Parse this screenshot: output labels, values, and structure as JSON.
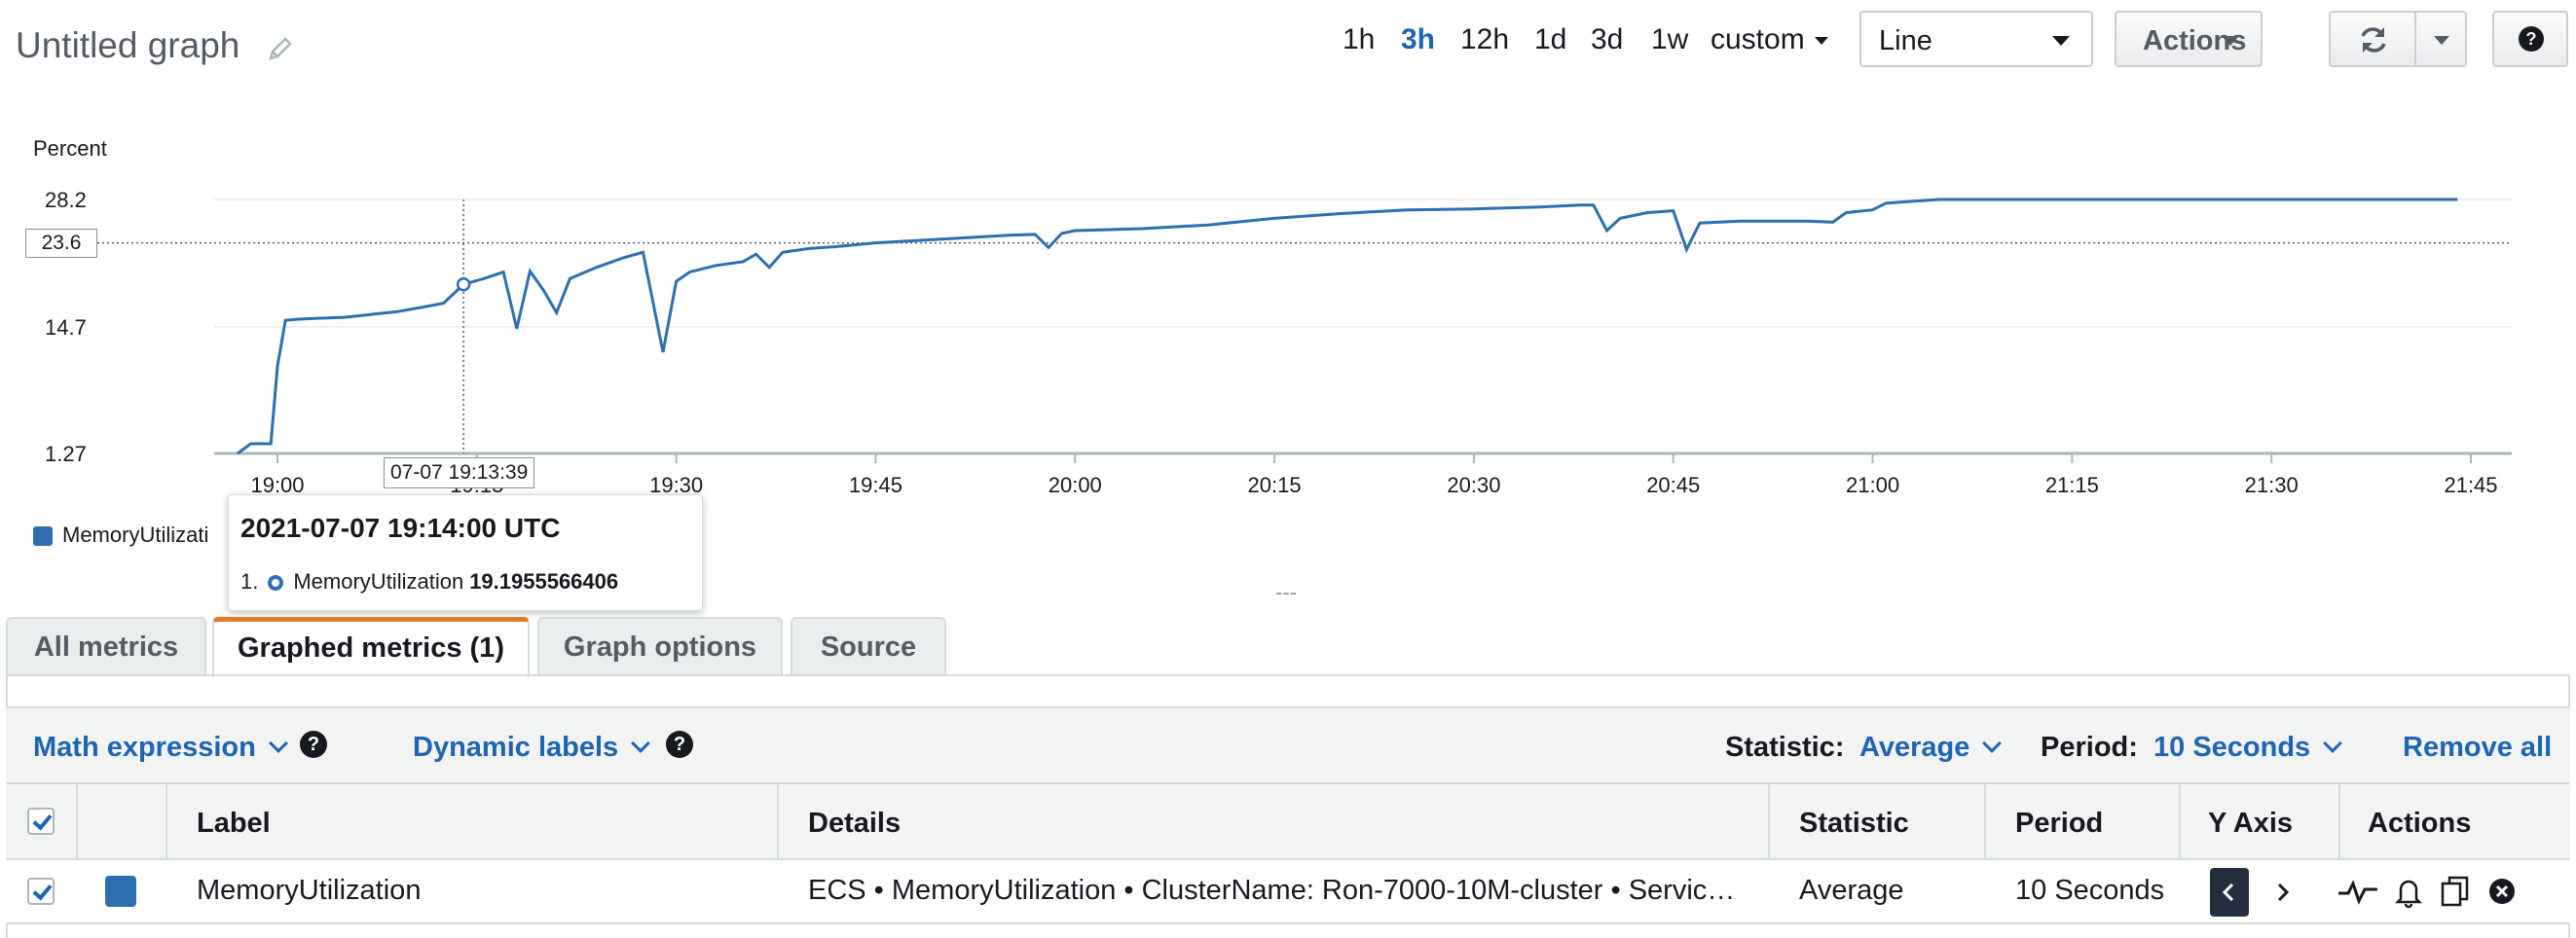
{
  "header": {
    "title": "Untitled graph",
    "time_ranges": [
      {
        "label": "1h",
        "active": false
      },
      {
        "label": "3h",
        "active": true
      },
      {
        "label": "12h",
        "active": false
      },
      {
        "label": "1d",
        "active": false
      },
      {
        "label": "3d",
        "active": false
      },
      {
        "label": "1w",
        "active": false
      }
    ],
    "custom_label": "custom",
    "graph_type": "Line",
    "actions_label": "Actions"
  },
  "chart_data": {
    "type": "line",
    "ylabel": "Percent",
    "y_ticks": [
      "28.2",
      "14.7",
      "1.27"
    ],
    "ylim": [
      1.27,
      28.2
    ],
    "x_ticks": [
      "19:00",
      "19:15",
      "19:30",
      "19:45",
      "20:00",
      "20:15",
      "20:30",
      "20:45",
      "21:00",
      "21:15",
      "21:30",
      "21:45"
    ],
    "xlim": [
      "18:57",
      "21:45"
    ],
    "grid": true,
    "legend": "bottom-left",
    "series": [
      {
        "name": "MemoryUtilization",
        "color": "#2e6fb0",
        "points": [
          [
            "18:57",
            1.27
          ],
          [
            "18:58",
            2.3
          ],
          [
            "18:59",
            2.3
          ],
          [
            "18:59.5",
            2.3
          ],
          [
            "19:00",
            10.5
          ],
          [
            "19:00.6",
            15.4
          ],
          [
            "19:01.5",
            15.5
          ],
          [
            "19:03",
            15.6
          ],
          [
            "19:05",
            15.7
          ],
          [
            "19:07",
            16.0
          ],
          [
            "19:09",
            16.3
          ],
          [
            "19:11",
            16.8
          ],
          [
            "19:12.5",
            17.2
          ],
          [
            "19:14",
            19.2
          ],
          [
            "19:15.5",
            19.8
          ],
          [
            "19:17",
            20.5
          ],
          [
            "19:18",
            14.5
          ],
          [
            "19:19",
            20.6
          ],
          [
            "19:20",
            18.6
          ],
          [
            "19:21",
            16.2
          ],
          [
            "19:22",
            19.8
          ],
          [
            "19:24",
            21.0
          ],
          [
            "19:26",
            22.0
          ],
          [
            "19:27.5",
            22.6
          ],
          [
            "19:29",
            12.0
          ],
          [
            "19:30",
            19.5
          ],
          [
            "19:31",
            20.5
          ],
          [
            "19:33",
            21.2
          ],
          [
            "19:35",
            21.6
          ],
          [
            "19:36",
            22.4
          ],
          [
            "19:37",
            21.0
          ],
          [
            "19:38",
            22.6
          ],
          [
            "19:40",
            23.0
          ],
          [
            "19:42",
            23.2
          ],
          [
            "19:45",
            23.6
          ],
          [
            "19:50",
            24.0
          ],
          [
            "19:55",
            24.4
          ],
          [
            "19:57",
            24.5
          ],
          [
            "19:58",
            23.1
          ],
          [
            "19:59",
            24.6
          ],
          [
            "20:00",
            24.9
          ],
          [
            "20:05",
            25.1
          ],
          [
            "20:10",
            25.5
          ],
          [
            "20:15",
            26.2
          ],
          [
            "20:20",
            26.7
          ],
          [
            "20:25",
            27.1
          ],
          [
            "20:30",
            27.2
          ],
          [
            "20:35",
            27.4
          ],
          [
            "20:38",
            27.6
          ],
          [
            "20:39",
            27.6
          ],
          [
            "20:40",
            24.9
          ],
          [
            "20:41",
            26.2
          ],
          [
            "20:43",
            26.8
          ],
          [
            "20:45",
            27.0
          ],
          [
            "20:46",
            22.9
          ],
          [
            "20:47",
            25.7
          ],
          [
            "20:50",
            25.9
          ],
          [
            "20:55",
            25.9
          ],
          [
            "20:57",
            25.8
          ],
          [
            "20:58",
            26.8
          ],
          [
            "21:00",
            27.1
          ],
          [
            "21:01",
            27.8
          ],
          [
            "21:03",
            28.0
          ],
          [
            "21:05",
            28.2
          ],
          [
            "21:10",
            28.2
          ],
          [
            "21:20",
            28.2
          ],
          [
            "21:30",
            28.2
          ],
          [
            "21:40",
            28.2
          ],
          [
            "21:44",
            28.2
          ]
        ]
      }
    ],
    "hover": {
      "time_label": "07-07 19:13:39",
      "value_label": "23.6",
      "x": "19:14",
      "y": 19.2,
      "crosshair_y": 23.6
    }
  },
  "tooltip": {
    "title": "2021-07-07 19:14:00 UTC",
    "index": "1.",
    "metric": "MemoryUtilization",
    "value": "19.1955566406"
  },
  "legend": {
    "label": "MemoryUtilizati"
  },
  "drag_handle": "---",
  "tabs": [
    {
      "label": "All metrics",
      "active": false
    },
    {
      "label": "Graphed metrics (1)",
      "active": true
    },
    {
      "label": "Graph options",
      "active": false
    },
    {
      "label": "Source",
      "active": false
    }
  ],
  "toolbar": {
    "math_expression": "Math expression",
    "dynamic_labels": "Dynamic labels",
    "statistic_label": "Statistic:",
    "statistic_value": "Average",
    "period_label": "Period:",
    "period_value": "10 Seconds",
    "remove_all": "Remove all"
  },
  "table": {
    "headers": {
      "label": "Label",
      "details": "Details",
      "statistic": "Statistic",
      "period": "Period",
      "yaxis": "Y Axis",
      "actions": "Actions"
    },
    "rows": [
      {
        "label": "MemoryUtilization",
        "details": "ECS • MemoryUtilization • ClusterName: Ron-7000-10M-cluster • Servic…",
        "statistic": "Average",
        "period": "10 Seconds",
        "color": "#2e6fb0"
      }
    ]
  }
}
